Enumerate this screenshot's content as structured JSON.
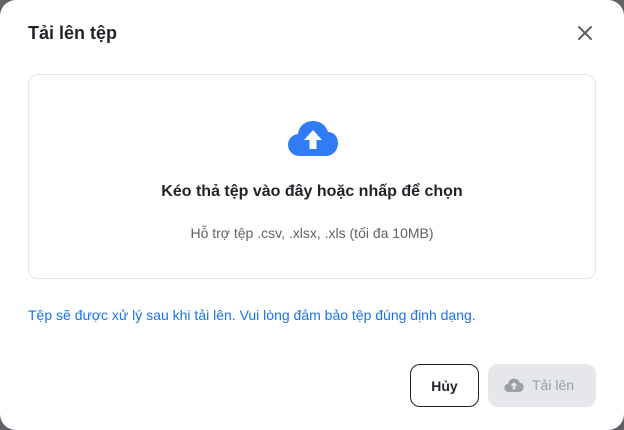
{
  "dialog": {
    "title": "Tải lên tệp",
    "close_icon": "close-icon"
  },
  "dropzone": {
    "icon": "cloud-upload-icon",
    "title": "Kéo thả tệp vào đây hoặc nhấp để chọn",
    "subtitle": "Hỗ trợ tệp .csv, .xlsx, .xls (tối đa 10MB)"
  },
  "note": "Tệp sẽ được xử lý sau khi tải lên. Vui lòng đảm bảo tệp đúng định dạng.",
  "footer": {
    "cancel_label": "Hủy",
    "upload_label": "Tải lên",
    "upload_icon": "cloud-upload-icon",
    "upload_disabled": true
  },
  "colors": {
    "accent": "#2f7cf6",
    "link": "#1a73e8",
    "disabled_bg": "#e5e7ea",
    "disabled_text": "#9aa0a6"
  }
}
